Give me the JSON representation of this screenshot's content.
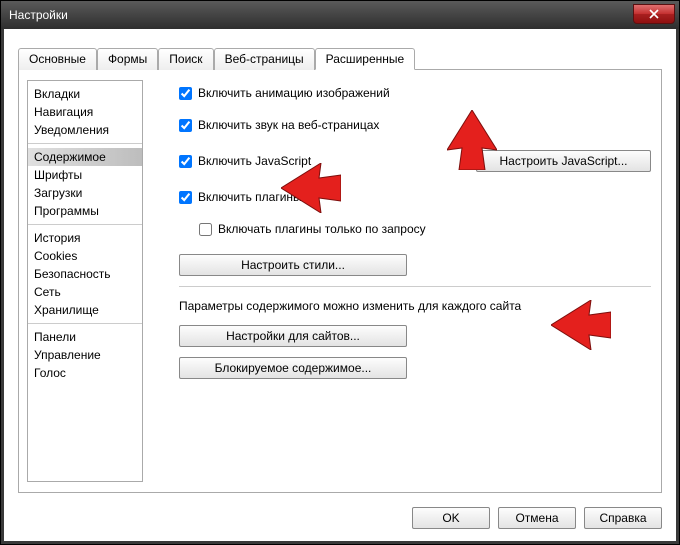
{
  "title": "Настройки",
  "tabs": {
    "t0": "Основные",
    "t1": "Формы",
    "t2": "Поиск",
    "t3": "Веб-страницы",
    "t4": "Расширенные"
  },
  "sidebar": {
    "g0": {
      "i0": "Вкладки",
      "i1": "Навигация",
      "i2": "Уведомления"
    },
    "g1": {
      "i0": "Содержимое",
      "i1": "Шрифты",
      "i2": "Загрузки",
      "i3": "Программы"
    },
    "g2": {
      "i0": "История",
      "i1": "Cookies",
      "i2": "Безопасность",
      "i3": "Сеть",
      "i4": "Хранилище"
    },
    "g3": {
      "i0": "Панели",
      "i1": "Управление",
      "i2": "Голос"
    }
  },
  "checks": {
    "anim": "Включить анимацию изображений",
    "sound": "Включить звук на веб-страницах",
    "js": "Включить JavaScript",
    "plugins": "Включить плагины",
    "plugins_demand": "Включать плагины только по запросу"
  },
  "buttons": {
    "js_config": "Настроить JavaScript...",
    "styles": "Настроить стили...",
    "sites": "Настройки для сайтов...",
    "blocked": "Блокируемое содержимое...",
    "ok": "OK",
    "cancel": "Отмена",
    "help": "Справка"
  },
  "section_text": "Параметры содержимого можно изменить для каждого сайта"
}
